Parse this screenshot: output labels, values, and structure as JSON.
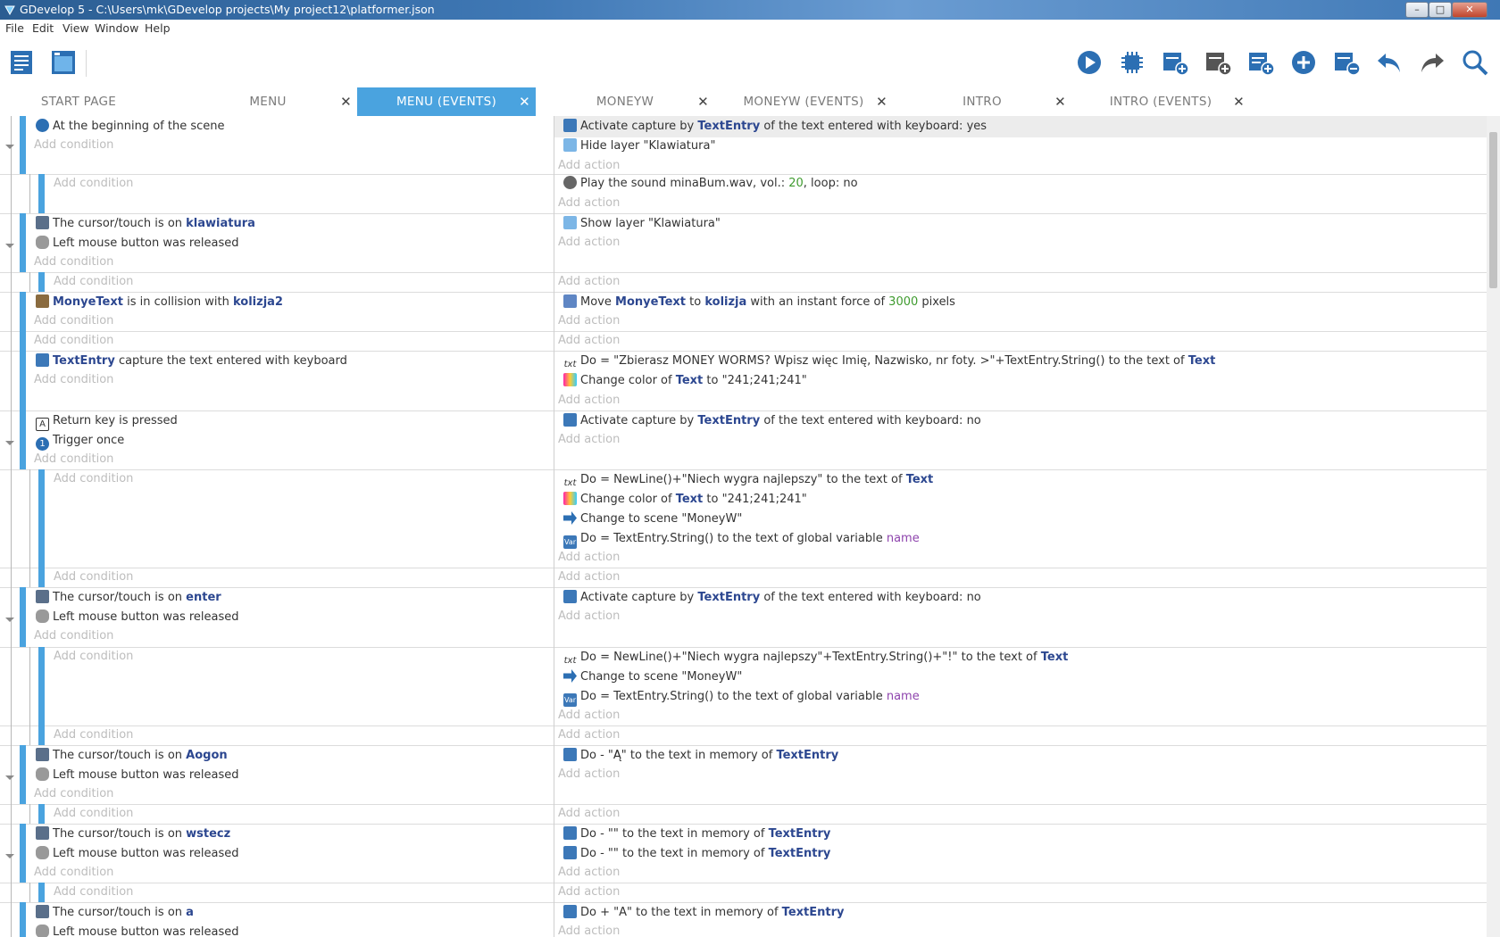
{
  "window": {
    "title": "GDevelop 5 - C:\\Users\\mk\\GDevelop projects\\My project12\\platformer.json",
    "controls": [
      "–",
      "□",
      "✕"
    ]
  },
  "menu": [
    "File",
    "Edit",
    "View",
    "Window",
    "Help"
  ],
  "toolbar": {
    "icons": [
      "project-manager-icon",
      "scene-icon",
      "preview-play-icon",
      "debugger-icon",
      "add-event-icon",
      "add-subevent-icon",
      "add-comment-icon",
      "add-other-icon",
      "delete-event-icon",
      "undo-icon",
      "redo-icon",
      "search-icon"
    ]
  },
  "tabs": [
    {
      "label": "START PAGE",
      "closable": false
    },
    {
      "label": "MENU",
      "closable": true
    },
    {
      "label": "MENU (EVENTS)",
      "closable": true,
      "active": true
    },
    {
      "label": "MONEYW",
      "closable": true
    },
    {
      "label": "MONEYW (EVENTS)",
      "closable": true
    },
    {
      "label": "INTRO",
      "closable": true
    },
    {
      "label": "INTRO (EVENTS)",
      "closable": true
    }
  ],
  "strings": {
    "add_condition": "Add condition",
    "add_action": "Add action",
    "to_the_text_of": "to the text of",
    "to_the_text_in_memory_of": "to the text in memory of",
    "to": "to",
    "left_mouse_released": "Left mouse button was released",
    "cursor_on": "The cursor/touch is on",
    "activate_capture_by": "Activate capture by",
    "of_text_entered": "of the text entered with keyboard:",
    "change_color_of": "Change color of",
    "change_to_scene": "Change to scene",
    "global_var_tail": "to the text of global variable"
  },
  "events": {
    "e1": {
      "cond": "At the beginning of the scene",
      "act1_val": "yes",
      "act2": "Hide layer \"Klawiatura\""
    },
    "e2": {
      "act1_pre": "Play the sound",
      "act1_file": "minaBum.wav,",
      "act1_vol": "vol.:",
      "act1_volv": "20",
      "act1_loop": ", loop:",
      "act1_loopv": "no"
    },
    "e3": {
      "obj": "klawiatura",
      "act": "Show layer \"Klawiatura\""
    },
    "e5": {
      "obj1": "MonyeText",
      "mid": "is in collision with",
      "obj2": "kolizja2",
      "act_pre": "Move",
      "act_obj": "MonyeText",
      "act_to": "to",
      "act_target": "kolizja",
      "act_mid": "with an instant force of",
      "act_num": "3000",
      "act_tail": "pixels"
    },
    "e7": {
      "obj": "TextEntry",
      "cond": "capture the text entered with keyboard",
      "act1": "Do = \"Zbierasz MONEY WORMS? Wpisz więc Imię, Nazwisko, nr foty. >\"+TextEntry.String()",
      "act1_obj": "Text",
      "act2_obj": "Text",
      "act2_val": "\"241;241;241\""
    },
    "e8": {
      "cond1": "Return key is pressed",
      "cond2": "Trigger once",
      "act_val": "no"
    },
    "e9": {
      "act1": "Do = NewLine()+\"Niech wygra najlepszy\"",
      "act1_obj": "Text",
      "act2_obj": "Text",
      "act2_val": "\"241;241;241\"",
      "act3": "\"MoneyW\"",
      "act4": "Do = TextEntry.String()",
      "act4_var": "name"
    },
    "e11": {
      "obj": "enter",
      "act_val": "no"
    },
    "e12": {
      "act1": "Do = NewLine()+\"Niech wygra najlepszy\"+TextEntry.String()+\"!\"",
      "act1_obj": "Text",
      "act2": "\"MoneyW\"",
      "act3": "Do = TextEntry.String()",
      "act3_var": "name"
    },
    "e14": {
      "obj": "Aogon",
      "act": "Do - \"Ą\""
    },
    "e16": {
      "obj": "wstecz",
      "act1": "Do - \"\"",
      "act2": "Do - \"\""
    },
    "e18": {
      "obj": "a",
      "act": "Do + \"A\""
    }
  },
  "colors": {
    "accent": "#4aa3df",
    "object_name": "#2c4790",
    "number": "#3f9b2f",
    "variable": "#8e44ad"
  }
}
